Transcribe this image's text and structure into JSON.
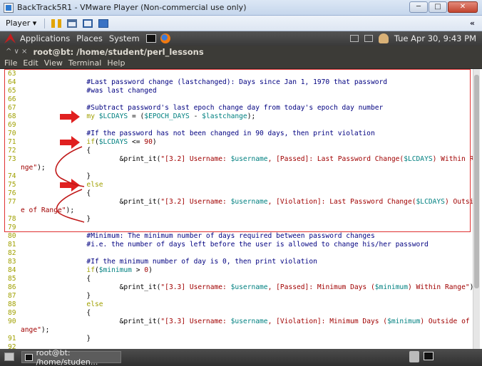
{
  "vmware": {
    "title": "BackTrack5R1 - VMware Player (Non-commercial use only)",
    "player_menu": "Player",
    "window_buttons": {
      "minimize": "─",
      "maximize": "□",
      "close": "✕"
    },
    "collapse_glyph": "«"
  },
  "gnome_panel": {
    "menus": [
      "Applications",
      "Places",
      "System"
    ],
    "clock": "Tue Apr 30,  9:43 PM"
  },
  "terminal": {
    "window_title": "root@bt: /home/student/perl_lessons",
    "title_controls": "^  ∨  ×",
    "menu": [
      "File",
      "Edit",
      "View",
      "Terminal",
      "Help"
    ]
  },
  "code_lines": [
    {
      "ln": "63",
      "parts": []
    },
    {
      "ln": "64",
      "parts": [
        {
          "t": "cm",
          "s": "                #Last password change (lastchanged): Days since Jan 1, 1970 that password"
        }
      ]
    },
    {
      "ln": "65",
      "parts": [
        {
          "t": "cm",
          "s": "                #was last changed"
        }
      ]
    },
    {
      "ln": "66",
      "parts": []
    },
    {
      "ln": "67",
      "parts": [
        {
          "t": "cm",
          "s": "                #Subtract password's last epoch change day from today's epoch day number"
        }
      ]
    },
    {
      "ln": "68",
      "parts": [
        {
          "t": "kw",
          "s": "                my "
        },
        {
          "t": "var",
          "s": "$LCDAYS"
        },
        {
          "t": "pl",
          "s": " = ("
        },
        {
          "t": "var",
          "s": "$EPOCH_DAYS"
        },
        {
          "t": "pl",
          "s": " - "
        },
        {
          "t": "var",
          "s": "$lastchange"
        },
        {
          "t": "pl",
          "s": ");"
        }
      ]
    },
    {
      "ln": "69",
      "parts": []
    },
    {
      "ln": "70",
      "parts": [
        {
          "t": "cm",
          "s": "                #If the password has not been changed in 90 days, then print violation"
        }
      ]
    },
    {
      "ln": "71",
      "parts": [
        {
          "t": "kw",
          "s": "                if"
        },
        {
          "t": "pl",
          "s": "("
        },
        {
          "t": "var",
          "s": "$LCDAYS"
        },
        {
          "t": "pl",
          "s": " <= "
        },
        {
          "t": "str",
          "s": "90"
        },
        {
          "t": "pl",
          "s": ")"
        }
      ]
    },
    {
      "ln": "72",
      "parts": [
        {
          "t": "pl",
          "s": "                {"
        }
      ]
    },
    {
      "ln": "73",
      "parts": [
        {
          "t": "pl",
          "s": "                        &print_it("
        },
        {
          "t": "str",
          "s": "\"[3.2] Username: "
        },
        {
          "t": "var",
          "s": "$username"
        },
        {
          "t": "str",
          "s": ", [Passed]: Last Password Change("
        },
        {
          "t": "var",
          "s": "$LCDAYS"
        },
        {
          "t": "str",
          "s": ") Within Ra"
        }
      ]
    },
    {
      "ln": "",
      "parts": [
        {
          "t": "str",
          "s": "nge\""
        },
        {
          "t": "pl",
          "s": ");"
        }
      ]
    },
    {
      "ln": "74",
      "parts": [
        {
          "t": "pl",
          "s": "                }"
        }
      ]
    },
    {
      "ln": "75",
      "parts": [
        {
          "t": "kw",
          "s": "                else"
        }
      ]
    },
    {
      "ln": "76",
      "parts": [
        {
          "t": "pl",
          "s": "                {"
        }
      ]
    },
    {
      "ln": "77",
      "parts": [
        {
          "t": "pl",
          "s": "                        &print_it("
        },
        {
          "t": "str",
          "s": "\"[3.2] Username: "
        },
        {
          "t": "var",
          "s": "$username"
        },
        {
          "t": "str",
          "s": ", [Violation]: Last Password Change("
        },
        {
          "t": "var",
          "s": "$LCDAYS"
        },
        {
          "t": "str",
          "s": ") Outsid"
        }
      ]
    },
    {
      "ln": "",
      "parts": [
        {
          "t": "str",
          "s": "e of Range\""
        },
        {
          "t": "pl",
          "s": ");"
        }
      ]
    },
    {
      "ln": "78",
      "parts": [
        {
          "t": "pl",
          "s": "                }"
        }
      ]
    },
    {
      "ln": "79",
      "parts": []
    },
    {
      "ln": "80",
      "parts": [
        {
          "t": "cm",
          "s": "                #Minimum: The minimum number of days required between password changes"
        }
      ]
    },
    {
      "ln": "81",
      "parts": [
        {
          "t": "cm",
          "s": "                #i.e. the number of days left before the user is allowed to change his/her password"
        }
      ]
    },
    {
      "ln": "82",
      "parts": []
    },
    {
      "ln": "83",
      "parts": [
        {
          "t": "cm",
          "s": "                #If the minimum number of day is 0, then print violation"
        }
      ]
    },
    {
      "ln": "84",
      "parts": [
        {
          "t": "kw",
          "s": "                if"
        },
        {
          "t": "pl",
          "s": "("
        },
        {
          "t": "var",
          "s": "$minimum"
        },
        {
          "t": "pl",
          "s": " > "
        },
        {
          "t": "str",
          "s": "0"
        },
        {
          "t": "pl",
          "s": ")"
        }
      ]
    },
    {
      "ln": "85",
      "parts": [
        {
          "t": "pl",
          "s": "                {"
        }
      ]
    },
    {
      "ln": "86",
      "parts": [
        {
          "t": "pl",
          "s": "                        &print_it("
        },
        {
          "t": "str",
          "s": "\"[3.3] Username: "
        },
        {
          "t": "var",
          "s": "$username"
        },
        {
          "t": "str",
          "s": ", [Passed]: Minimum Days ("
        },
        {
          "t": "var",
          "s": "$minimum"
        },
        {
          "t": "str",
          "s": ") Within Range\""
        },
        {
          "t": "pl",
          "s": ");"
        }
      ]
    },
    {
      "ln": "87",
      "parts": [
        {
          "t": "pl",
          "s": "                }"
        }
      ]
    },
    {
      "ln": "88",
      "parts": [
        {
          "t": "kw",
          "s": "                else"
        }
      ]
    },
    {
      "ln": "89",
      "parts": [
        {
          "t": "pl",
          "s": "                {"
        }
      ]
    },
    {
      "ln": "90",
      "parts": [
        {
          "t": "pl",
          "s": "                        &print_it("
        },
        {
          "t": "str",
          "s": "\"[3.3] Username: "
        },
        {
          "t": "var",
          "s": "$username"
        },
        {
          "t": "str",
          "s": ", [Violation]: Minimum Days ("
        },
        {
          "t": "var",
          "s": "$minimum"
        },
        {
          "t": "str",
          "s": ") Outside of R"
        }
      ]
    },
    {
      "ln": "",
      "parts": [
        {
          "t": "str",
          "s": "ange\""
        },
        {
          "t": "pl",
          "s": ");"
        }
      ]
    },
    {
      "ln": "91",
      "parts": [
        {
          "t": "pl",
          "s": "                }"
        }
      ]
    },
    {
      "ln": "92",
      "parts": []
    }
  ],
  "taskbar": {
    "task_label": "root@bt: /home/studen..."
  },
  "colors": {
    "annotation_red": "#e02020",
    "line_number": "#a0a000",
    "comment": "#000080",
    "variable": "#008080",
    "string": "#a00000"
  }
}
